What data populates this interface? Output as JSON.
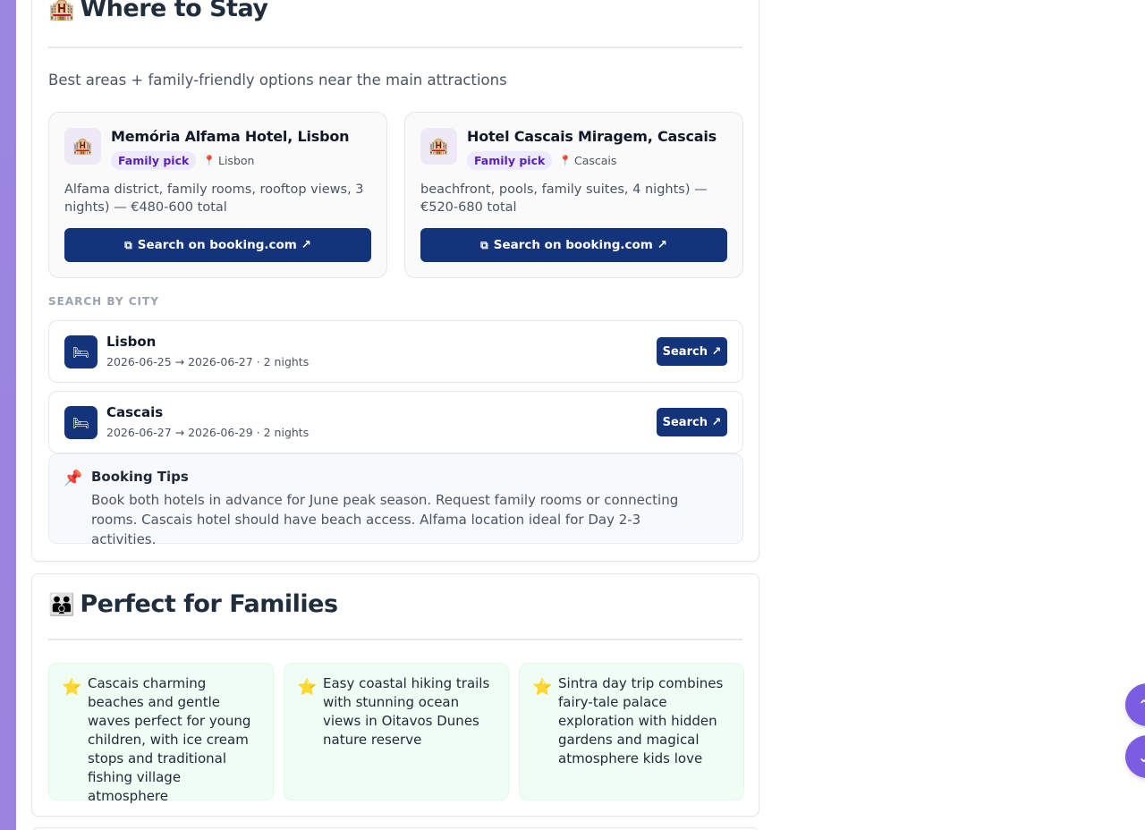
{
  "where_to_stay": {
    "emoji": "🏨",
    "title": "Where to Stay",
    "subtitle": "Best areas + family-friendly options near the main attractions",
    "hotels": [
      {
        "icon": "🏨",
        "name": "Memória Alfama Hotel, Lisbon",
        "badge": "Family pick",
        "pin": "📍",
        "location": "Lisbon",
        "description": "Alfama district, family rooms, rooftop views, 3 nights) — €480-600 total",
        "button_label": "Search on booking.com ↗"
      },
      {
        "icon": "🏨",
        "name": "Hotel Cascais Miragem, Cascais",
        "badge": "Family pick",
        "pin": "📍",
        "location": "Cascais",
        "description": "beachfront, pools, family suites, 4 nights) — €520-680 total",
        "button_label": "Search on booking.com ↗"
      }
    ],
    "search_by_city_label": "SEARCH BY CITY",
    "cities": [
      {
        "name": "Lisbon",
        "dates": "2026-06-25 → 2026-06-27 · 2 nights",
        "button_label": "Search ↗"
      },
      {
        "name": "Cascais",
        "dates": "2026-06-27 → 2026-06-29 · 2 nights",
        "button_label": "Search ↗"
      }
    ],
    "tips": {
      "icon": "📌",
      "title": "Booking Tips",
      "body": "Book both hotels in advance for June peak season. Request family rooms or connecting rooms. Cascais hotel should have beach access. Alfama location ideal for Day 2-3 activities."
    }
  },
  "families": {
    "emoji": "👪",
    "title": "Perfect for Families",
    "items": [
      {
        "star": "⭐",
        "text": "Cascais charming beaches and gentle waves perfect for young children, with ice cream stops and traditional fishing village atmosphere"
      },
      {
        "star": "⭐",
        "text": "Easy coastal hiking trails with stunning ocean views in Oitavos Dunes nature reserve"
      },
      {
        "star": "⭐",
        "text": "Sintra day trip combines fairy-tale palace exploration with hidden gardens and magical atmosphere kids love"
      }
    ]
  },
  "scroll_controls": {
    "up_glyph": "⌃",
    "down_glyph": "⌄"
  },
  "colors": {
    "primary": "#13337a",
    "accent_purple": "#7c5ce0",
    "badge_bg": "#ede9fe",
    "family_card_bg": "#f0fdf4"
  },
  "icons": {
    "external_link": "external-link-icon",
    "bed": "bed-icon",
    "pin": "map-pin-icon",
    "star": "star-icon"
  }
}
